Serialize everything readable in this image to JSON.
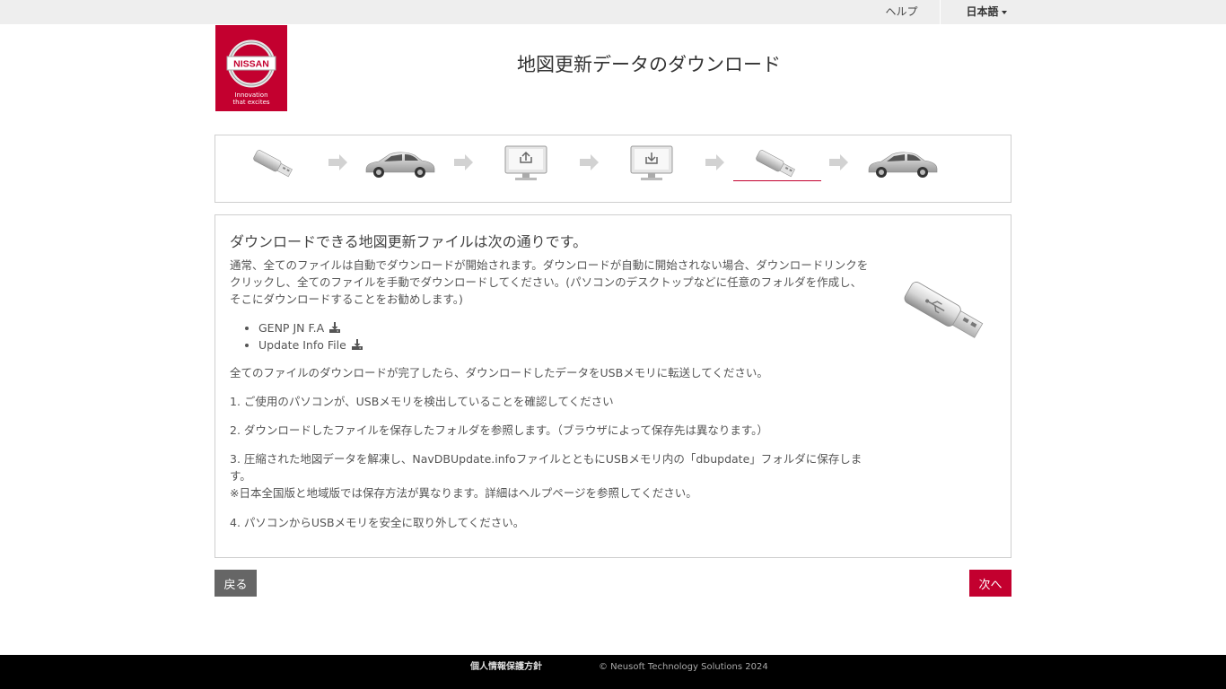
{
  "topbar": {
    "help_label": "ヘルプ",
    "language_label": "日本語"
  },
  "brand": {
    "name": "NISSAN",
    "tagline_line1": "Innovation",
    "tagline_line2": "that excites"
  },
  "page": {
    "title": "地図更新データのダウンロード"
  },
  "steps": {
    "active_index": 4
  },
  "content": {
    "heading": "ダウンロードできる地図更新ファイルは次の通りです。",
    "intro": "通常、全てのファイルは自動でダウンロードが開始されます。ダウンロードが自動に開始されない場合、ダウンロードリンクをクリックし、全てのファイルを手動でダウンロードしてください。(パソコンのデスクトップなどに任意のフォルダを作成し、そこにダウンロードすることをお勧めします。)",
    "files": [
      "GENP JN F.A",
      "Update Info File"
    ],
    "after_download": "全てのファイルのダウンロードが完了したら、ダウンロードしたデータをUSBメモリに転送してください。",
    "step1": "1. ご使用のパソコンが、USBメモリを検出していることを確認してください",
    "step2": "2. ダウンロードしたファイルを保存したフォルダを参照します。（ブラウザによって保存先は異なります。）",
    "step3": "3. 圧縮された地図データを解凍し、NavDBUpdate.infoファイルとともにUSBメモリ内の「dbupdate」フォルダに保存します。",
    "step3_note": "※日本全国版と地域版では保存方法が異なります。詳細はヘルプページを参照してください。",
    "step4": "4. パソコンからUSBメモリを安全に取り外してください。"
  },
  "buttons": {
    "back_label": "戻る",
    "next_label": "次へ"
  },
  "footer": {
    "privacy_label": "個人情報保護方針",
    "copyright": "© Neusoft Technology Solutions 2024"
  },
  "colors": {
    "brand_red": "#c3002f",
    "back_button": "#666666",
    "footer_bg": "#000000",
    "topbar_bg": "#eeeeee"
  }
}
